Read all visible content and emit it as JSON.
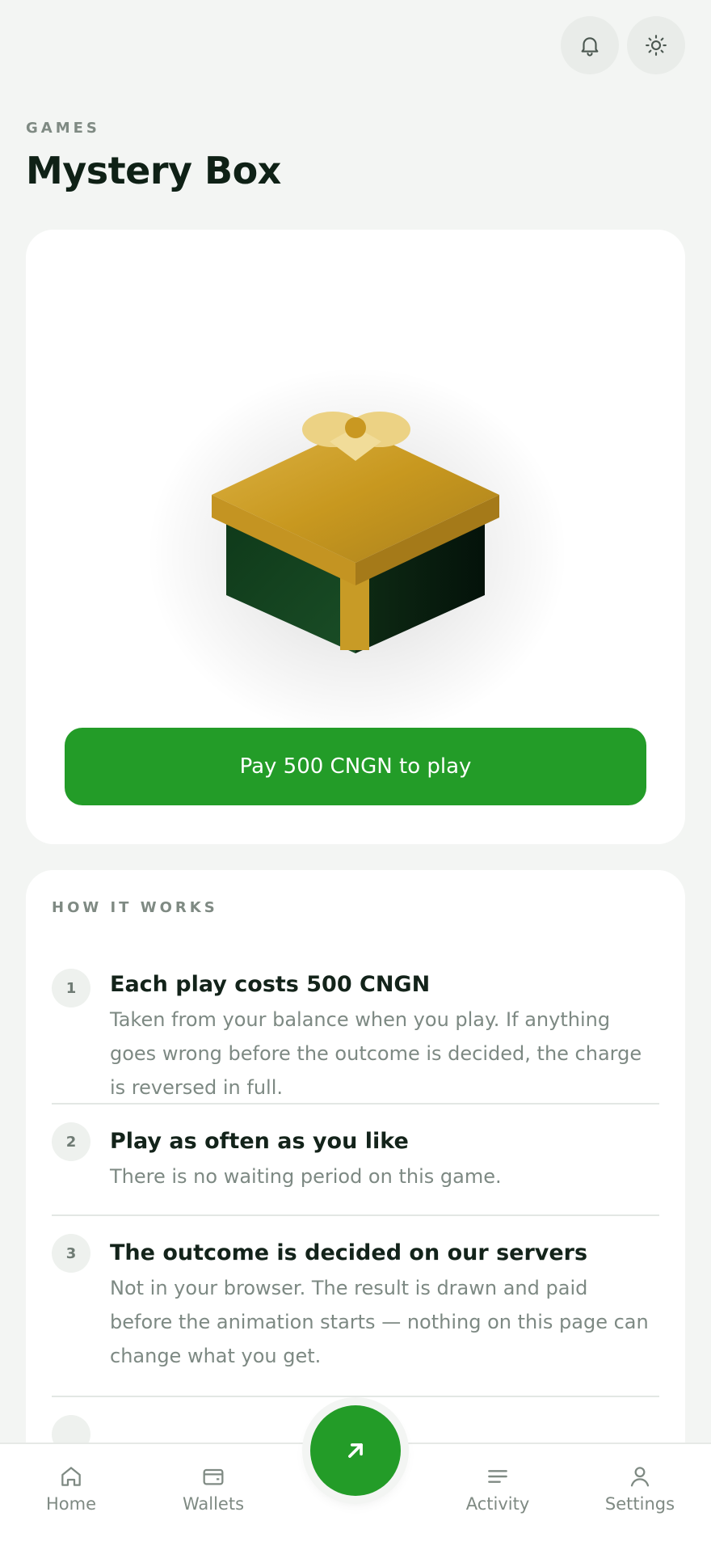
{
  "header": {
    "eyebrow": "GAMES",
    "title": "Mystery Box",
    "actions": [
      {
        "icon": "bell-icon"
      },
      {
        "icon": "sun-icon"
      }
    ]
  },
  "game": {
    "illustration": "mystery-box",
    "play_label": "Pay 500 CNGN to play"
  },
  "how_it_works": {
    "eyebrow": "HOW IT WORKS",
    "steps": [
      {
        "number": "1",
        "title": "Each play costs 500 CNGN",
        "desc_lines": [
          "Taken from your balance when you play. If anything",
          "goes wrong before the outcome is decided, the charge",
          "is reversed in full."
        ]
      },
      {
        "number": "2",
        "title": "Play as often as you like",
        "desc_lines": [
          "There is no waiting period on this game."
        ]
      },
      {
        "number": "3",
        "title": "The outcome is decided on our servers",
        "desc_lines": [
          "Not in your browser. The result is drawn and paid",
          "before the animation starts — nothing on this page can",
          "change what you get."
        ]
      }
    ]
  },
  "nav": {
    "items": [
      {
        "label": "Home",
        "icon": "home-icon"
      },
      {
        "label": "Wallets",
        "icon": "wallet-icon"
      },
      {
        "label": "Activity",
        "icon": "activity-icon"
      },
      {
        "label": "Settings",
        "icon": "user-icon"
      }
    ],
    "fab_icon": "arrow-up-right-icon"
  },
  "colors": {
    "accent": "#239c28",
    "background": "#f3f5f3",
    "box_gold": "#c79a27",
    "box_green": "#143d1e"
  }
}
